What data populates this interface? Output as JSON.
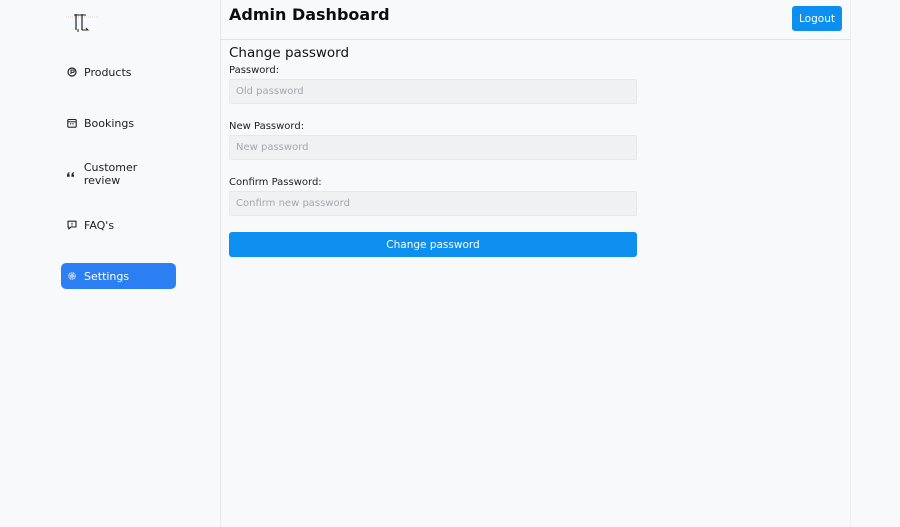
{
  "colors": {
    "accent": "#0d8ff0",
    "active_nav": "#2b7ff2",
    "background": "#f8f9fb"
  },
  "sidebar": {
    "logo": "logo",
    "items": [
      {
        "label": "Products",
        "icon": "products-circle-icon",
        "active": false
      },
      {
        "label": "Bookings",
        "icon": "calendar-icon",
        "active": false
      },
      {
        "label": "Customer review",
        "icon": "quote-icon",
        "active": false
      },
      {
        "label": "FAQ's",
        "icon": "faq-chat-icon",
        "active": false
      },
      {
        "label": "Settings",
        "icon": "gear-icon",
        "active": true
      }
    ]
  },
  "header": {
    "title": "Admin Dashboard",
    "logout_label": "Logout"
  },
  "form": {
    "title": "Change password",
    "password_label": "Password:",
    "password_placeholder": "Old password",
    "new_password_label": "New Password:",
    "new_password_placeholder": "New password",
    "confirm_label": "Confirm Password:",
    "confirm_placeholder": "Confirm new password",
    "submit_label": "Change password"
  }
}
